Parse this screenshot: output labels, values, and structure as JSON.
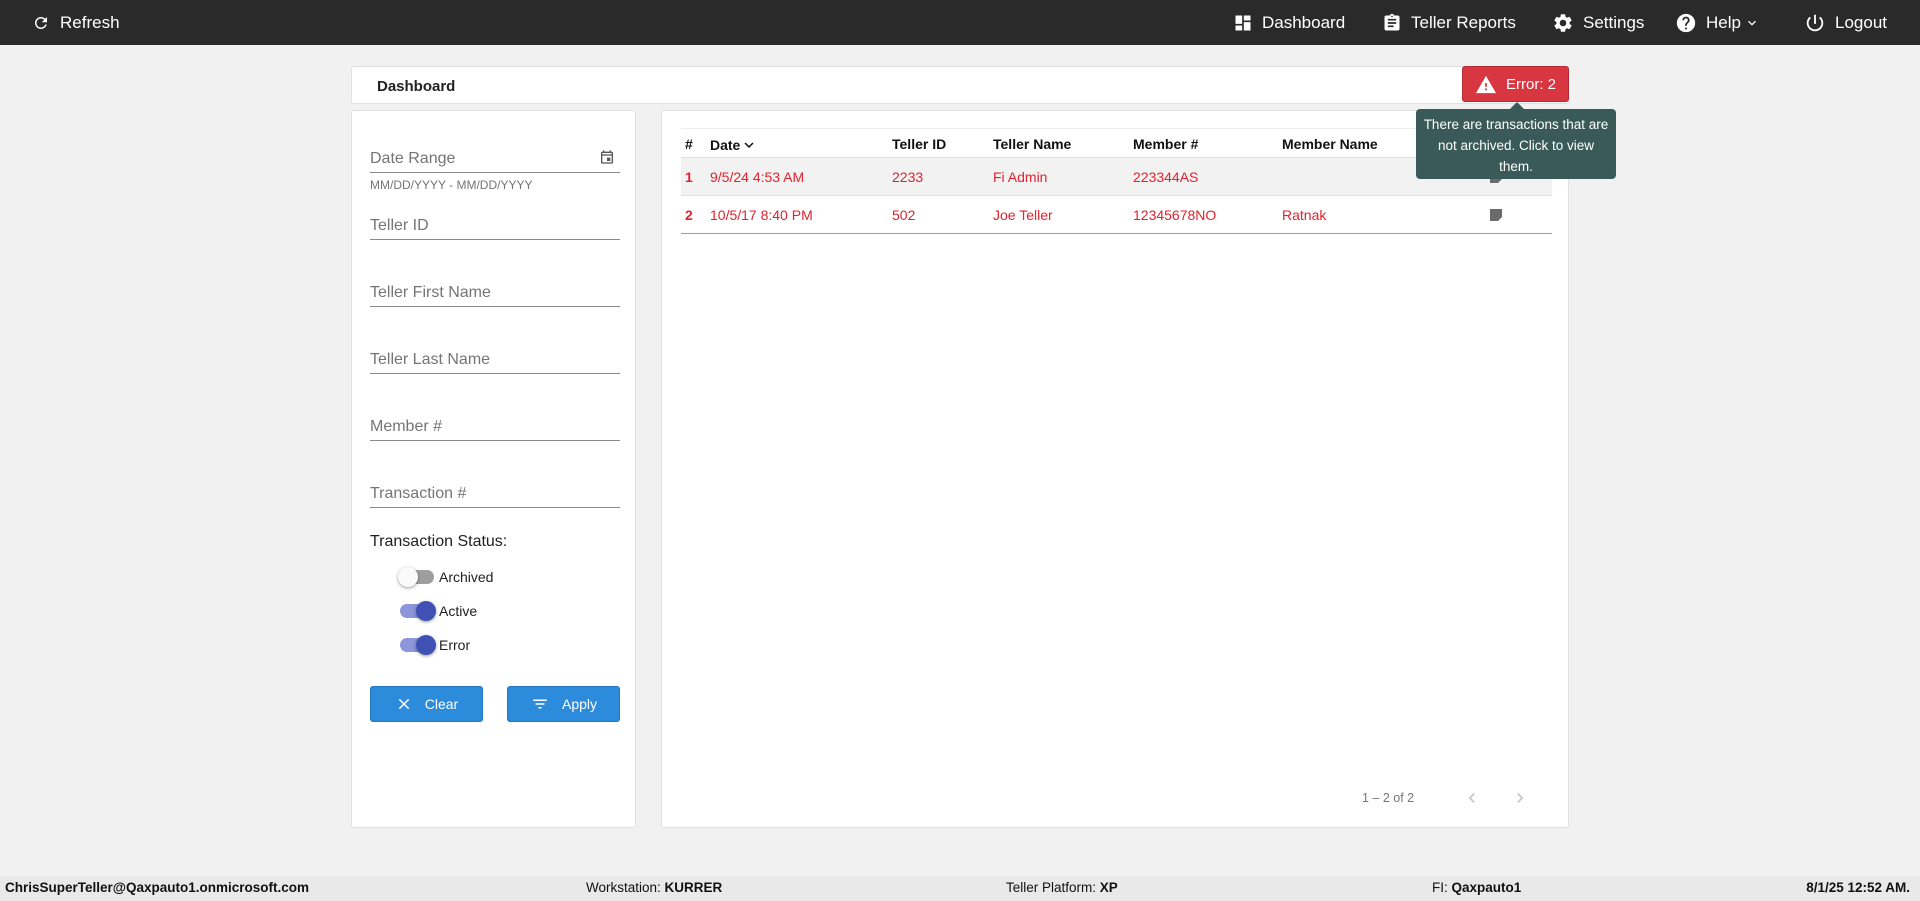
{
  "topbar": {
    "refresh_label": "Refresh",
    "nav": {
      "dashboard": "Dashboard",
      "teller_reports": "Teller Reports",
      "settings": "Settings",
      "help": "Help",
      "logout": "Logout"
    }
  },
  "header": {
    "title": "Dashboard",
    "error_badge": "Error: 2",
    "tooltip": "There are transactions that are not archived. Click to view them."
  },
  "filters": {
    "date_range_placeholder": "Date Range",
    "date_hint": "MM/DD/YYYY - MM/DD/YYYY",
    "teller_id_placeholder": "Teller ID",
    "teller_first_name_placeholder": "Teller First Name",
    "teller_last_name_placeholder": "Teller Last Name",
    "member_placeholder": "Member #",
    "transaction_placeholder": "Transaction #",
    "status_label": "Transaction Status:",
    "toggles": [
      {
        "label": "Archived",
        "on": false
      },
      {
        "label": "Active",
        "on": true
      },
      {
        "label": "Error",
        "on": true
      }
    ],
    "clear_label": "Clear",
    "apply_label": "Apply"
  },
  "table": {
    "headers": {
      "index": "#",
      "date": "Date",
      "teller_id": "Teller ID",
      "teller_name": "Teller Name",
      "member_num": "Member #",
      "member_name": "Member Name"
    },
    "rows": [
      {
        "index": "1",
        "date": "9/5/24 4:53 AM",
        "teller_id": "2233",
        "teller_name": "Fi Admin",
        "member_num": "223344AS",
        "member_name": ""
      },
      {
        "index": "2",
        "date": "10/5/17 8:40 PM",
        "teller_id": "502",
        "teller_name": "Joe Teller",
        "member_num": "12345678NO",
        "member_name": "Ratnak"
      }
    ],
    "paginator": "1 – 2 of 2"
  },
  "footer": {
    "user": "ChrisSuperTeller@Qaxpauto1.onmicrosoft.com",
    "workstation_label": "Workstation:",
    "workstation": "KURRER",
    "platform_label": "Teller Platform:",
    "platform": "XP",
    "fi_label": "FI:",
    "fi": "Qaxpauto1",
    "datetime": "8/1/25 12:52 AM."
  },
  "colors": {
    "topbar": "#2a2a2a",
    "error": "#d83640",
    "primary_button": "#2d8bdb",
    "toggle_on": "#3f51b5",
    "row_text": "#e4212e",
    "tooltip": "#3a5a5a"
  }
}
